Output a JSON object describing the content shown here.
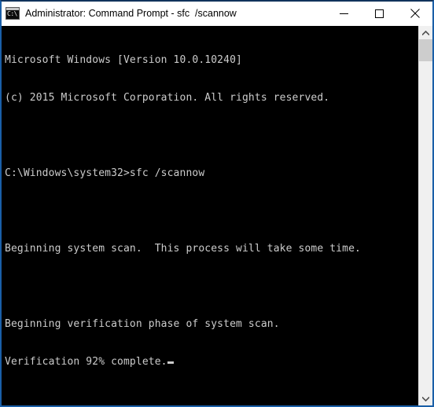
{
  "window": {
    "title": "Administrator: Command Prompt - sfc  /scannow",
    "icon": "command-prompt-icon",
    "icon_prompt_glyph": "C:\\",
    "border_color": "#1a5fa8",
    "titlebar_background": "#ffffff",
    "console_background": "#000000",
    "console_foreground": "#cccccc"
  },
  "window_controls": {
    "minimize_label": "Minimize",
    "maximize_label": "Maximize",
    "close_label": "Close"
  },
  "console": {
    "lines": [
      "Microsoft Windows [Version 10.0.10240]",
      "(c) 2015 Microsoft Corporation. All rights reserved.",
      "",
      "C:\\Windows\\system32>sfc /scannow",
      "",
      "Beginning system scan.  This process will take some time.",
      "",
      "Beginning verification phase of system scan.",
      "Verification 92% complete."
    ],
    "cursor_visible": true,
    "progress_percent": 92,
    "command": "sfc /scannow",
    "prompt_path": "C:\\Windows\\system32>"
  },
  "scrollbar": {
    "up_arrow": "chevron-up-icon",
    "down_arrow": "chevron-down-icon",
    "thumb_color": "#cdcdcd",
    "track_color": "#f0f0f0"
  }
}
